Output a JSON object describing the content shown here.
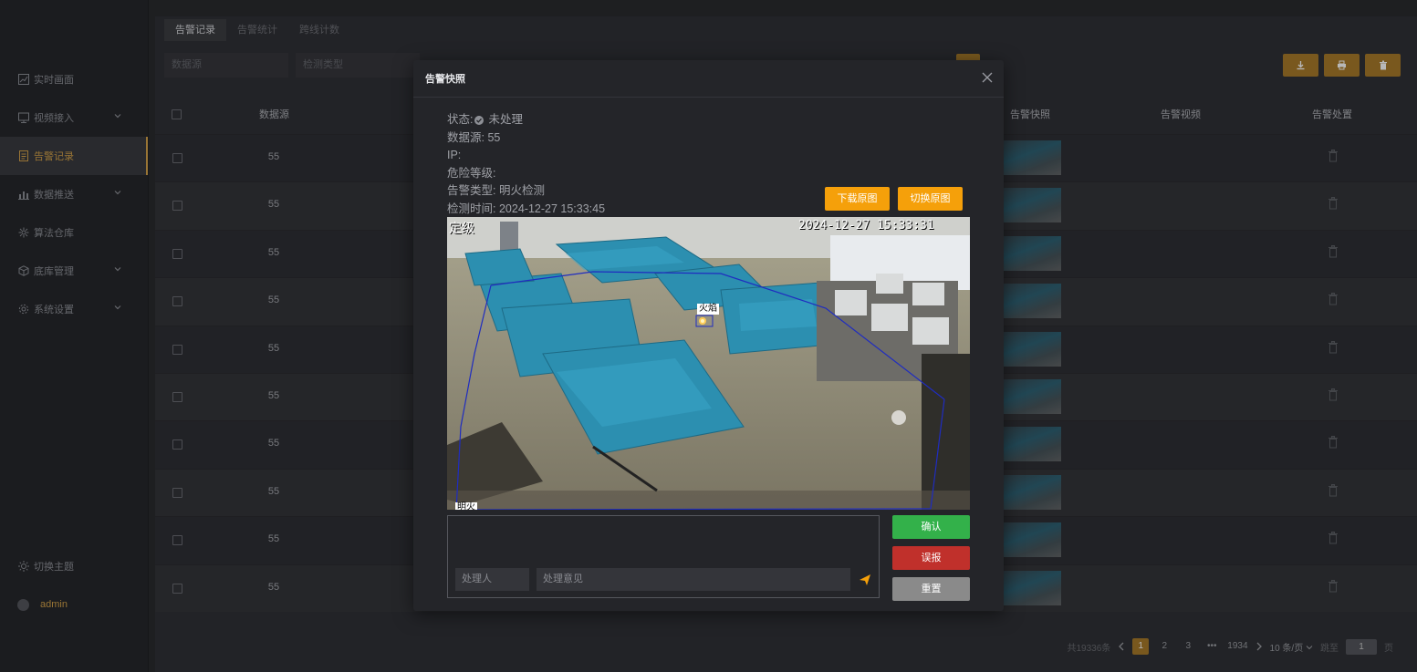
{
  "sidebar": {
    "items": [
      {
        "label": "实时画面",
        "icon": "chart-icon",
        "has_children": false
      },
      {
        "label": "视频接入",
        "icon": "monitor-icon",
        "has_children": true
      },
      {
        "label": "告警记录",
        "icon": "document-icon",
        "has_children": false,
        "active": true
      },
      {
        "label": "数据推送",
        "icon": "bar-chart-icon",
        "has_children": true
      },
      {
        "label": "算法仓库",
        "icon": "algorithm-icon",
        "has_children": false
      },
      {
        "label": "底库管理",
        "icon": "cube-icon",
        "has_children": true
      },
      {
        "label": "系统设置",
        "icon": "gear-icon",
        "has_children": true
      }
    ],
    "theme_label": "切换主题",
    "user_label": "admin"
  },
  "tabs": [
    "告警记录",
    "告警统计",
    "跨线计数"
  ],
  "filters": {
    "datasource_placeholder": "数据源",
    "type_placeholder": "检测类型"
  },
  "table": {
    "headers": {
      "datasource": "数据源",
      "snapshot": "告警快照",
      "video": "告警视频",
      "handle": "告警处置"
    },
    "rows": [
      {
        "source": "55"
      },
      {
        "source": "55"
      },
      {
        "source": "55"
      },
      {
        "source": "55"
      },
      {
        "source": "55"
      },
      {
        "source": "55"
      },
      {
        "source": "55"
      },
      {
        "source": "55"
      },
      {
        "source": "55"
      },
      {
        "source": "55"
      }
    ]
  },
  "pagination": {
    "total": "共19336条",
    "pages": [
      "1",
      "2",
      "3"
    ],
    "ellipsis": "•••",
    "last": "1934",
    "page_size": "10 条/页",
    "jump_label": "跳至",
    "jump_value": "1",
    "page_suffix": "页"
  },
  "modal": {
    "title": "告警快照",
    "status_label": "状态:",
    "status_value": "未处理",
    "source_label": "数据源:",
    "source_value": "55",
    "ip_label": "IP:",
    "ip_value": "",
    "risk_label": "危险等级:",
    "risk_value": "",
    "type_label": "告警类型:",
    "type_value": "明火检测",
    "time_label": "检测时间:",
    "time_value": "2024-12-27 15:33:45",
    "download_btn": "下载原图",
    "switch_btn": "切换原图",
    "snapshot_overlay_left": "定级",
    "snapshot_overlay_time": "2024-12-27 15:33:31",
    "detection_label": "火焰",
    "region_label": "明火",
    "handler_placeholder": "处理人",
    "opinion_placeholder": "处理意见",
    "confirm_btn": "确认",
    "false_btn": "误报",
    "reset_btn": "重置"
  },
  "colors": {
    "accent": "#d4a24a",
    "orange": "#f5a00a",
    "green": "#33b14a",
    "red": "#c0302b",
    "gray": "#8a8a8a"
  }
}
